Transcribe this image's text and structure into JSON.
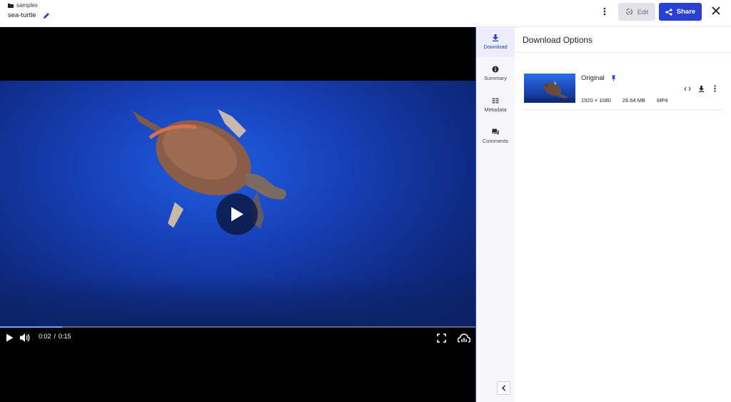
{
  "header": {
    "breadcrumb": "samples",
    "asset_title": "sea-turtle",
    "edit_label": "Edit",
    "share_label": "Share",
    "icons": {
      "folder": "folder-icon",
      "rename": "pencil-icon",
      "more": "more-vertical-icon",
      "edit": "edit-sync-icon",
      "share": "share-icon",
      "close": "close-icon"
    },
    "colors": {
      "share_bg": "#2a3fd4",
      "edit_bg": "#e2e3e8"
    }
  },
  "player": {
    "current_time": "0:02",
    "separator": "/",
    "duration": "0:15",
    "progress": 0.13,
    "icons": {
      "play_overlay": "play-circle-icon",
      "play": "play-icon",
      "volume": "volume-icon",
      "fullscreen": "fullscreen-icon",
      "cast": "cloud-stream-icon"
    }
  },
  "rail": {
    "tabs": [
      {
        "label": "Download",
        "icon": "download-icon",
        "active": true
      },
      {
        "label": "Summary",
        "icon": "info-icon",
        "active": false
      },
      {
        "label": "Metadata",
        "icon": "metadata-icon",
        "active": false
      },
      {
        "label": "Comments",
        "icon": "comments-icon",
        "active": false
      }
    ],
    "collapse_icon": "chevron-left-icon"
  },
  "panel": {
    "title": "Download Options",
    "rendition": {
      "name": "Original",
      "dimensions": "1920 × 1080",
      "size": "26.64 MB",
      "format": "MP4",
      "icons": [
        "pin-icon",
        "embed-code-icon",
        "download-icon",
        "more-vertical-icon"
      ]
    }
  }
}
